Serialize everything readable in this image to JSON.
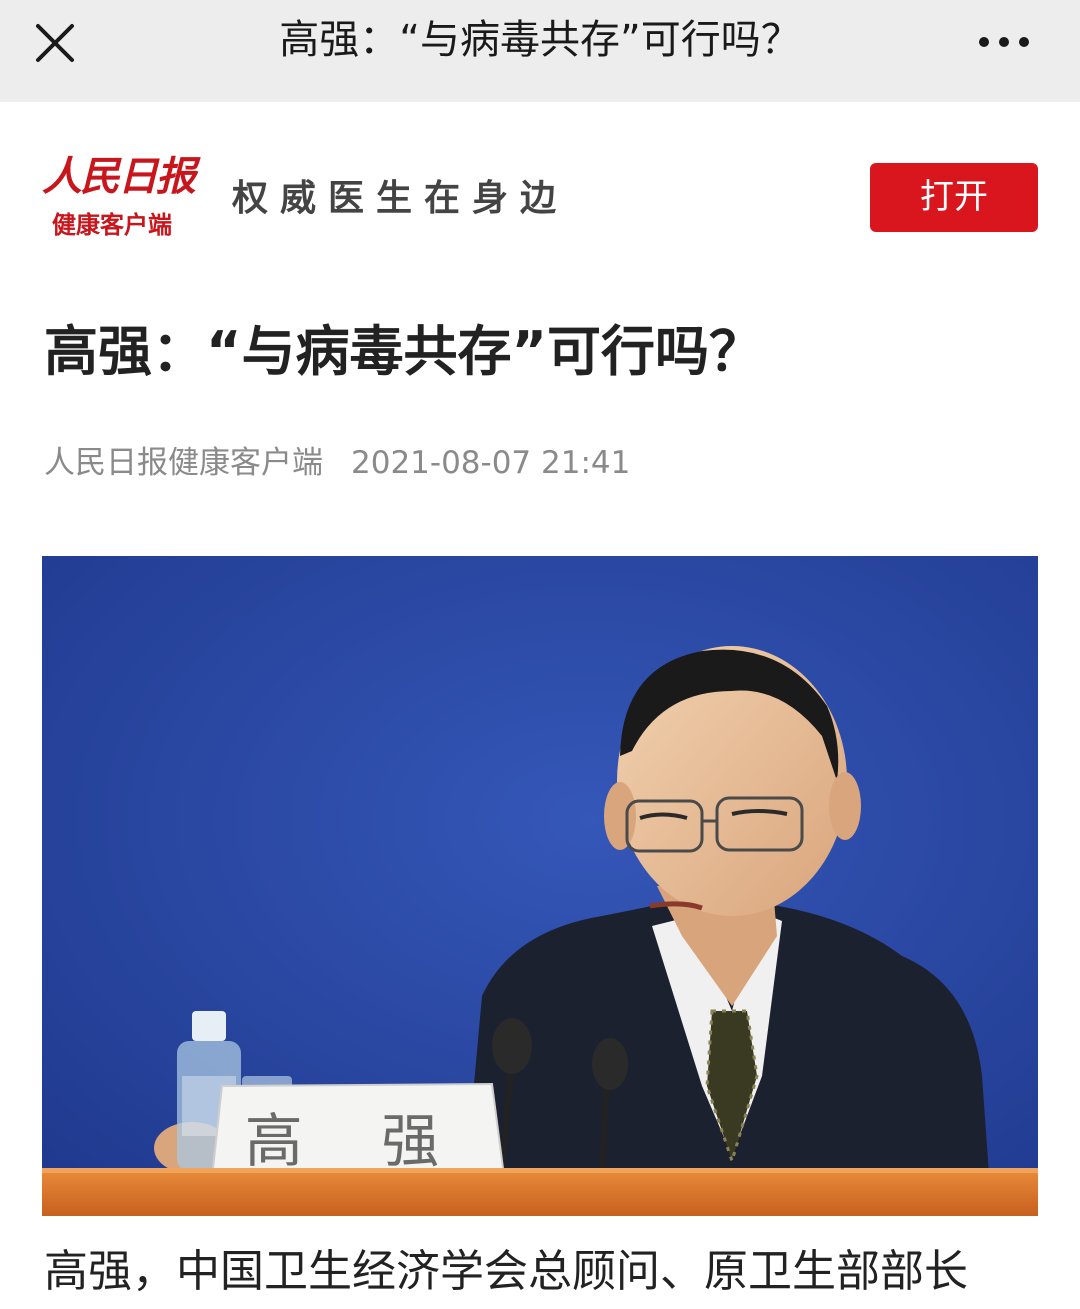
{
  "nav": {
    "title": "高强：“与病毒共存”可行吗？",
    "close_icon": "close-icon",
    "more_icon": "more-horizontal-icon"
  },
  "brand": {
    "logo_main": "人民日报",
    "logo_sub": "健康客户端",
    "slogan": "权威医生在身边",
    "open_label": "打开",
    "accent_color": "#d9161d"
  },
  "article": {
    "title": "高强：“与病毒共存”可行吗？",
    "source": "人民日报健康客户端",
    "date": "2021-08-07 21:41",
    "photo_nameplate": "高 强",
    "first_line": "高强，中国卫生经济学会总顾问、原卫生部部长"
  }
}
